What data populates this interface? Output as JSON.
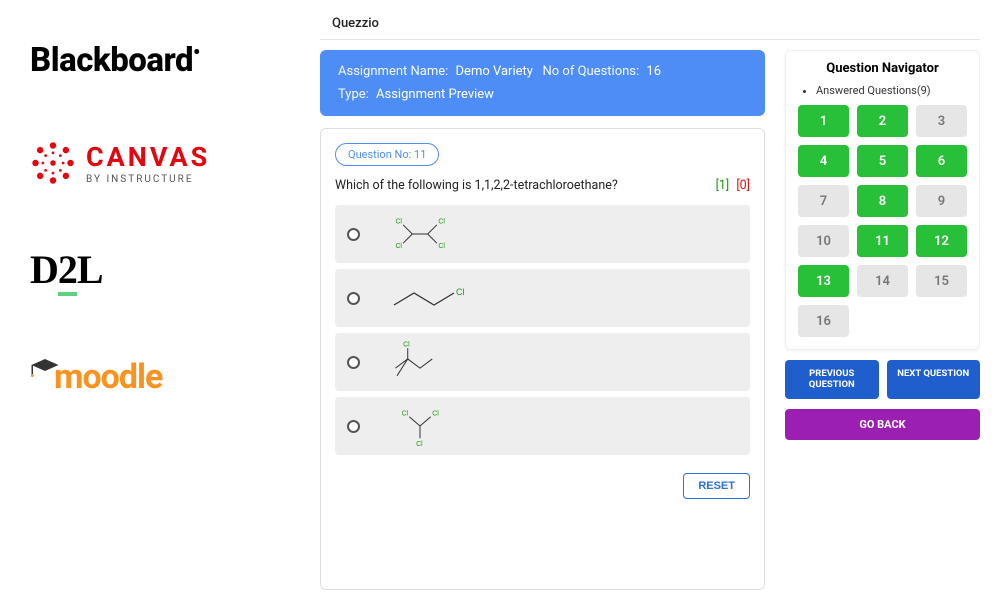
{
  "lms_logos": {
    "blackboard": "Blackboard",
    "canvas_top": "CANVAS",
    "canvas_sub": "BY INSTRUCTURE",
    "d2l": "D2L",
    "moodle": "moodle"
  },
  "app_title": "Quezzio",
  "info": {
    "assignment_label": "Assignment Name:",
    "assignment_value": "Demo Variety",
    "count_label": "No of Questions:",
    "count_value": "16",
    "type_label": "Type:",
    "type_value": "Assignment Preview"
  },
  "question": {
    "badge": "Question No: 11",
    "prompt": "Which of the following is 1,1,2,2-tetrachloroethane?",
    "score_attempt": "[1]",
    "score_missed": "[0]",
    "reset_label": "RESET"
  },
  "navigator": {
    "title": "Question Navigator",
    "legend": "Answered Questions(9)",
    "cells": [
      {
        "n": "1",
        "answered": true
      },
      {
        "n": "2",
        "answered": true
      },
      {
        "n": "3",
        "answered": false
      },
      {
        "n": "4",
        "answered": true
      },
      {
        "n": "5",
        "answered": true
      },
      {
        "n": "6",
        "answered": true
      },
      {
        "n": "7",
        "answered": false
      },
      {
        "n": "8",
        "answered": true
      },
      {
        "n": "9",
        "answered": false
      },
      {
        "n": "10",
        "answered": false
      },
      {
        "n": "11",
        "answered": true
      },
      {
        "n": "12",
        "answered": true
      },
      {
        "n": "13",
        "answered": true
      },
      {
        "n": "14",
        "answered": false
      },
      {
        "n": "15",
        "answered": false
      },
      {
        "n": "16",
        "answered": false
      }
    ],
    "prev_label": "PREVIOUS QUESTION",
    "next_label": "NEXT QUESTION",
    "goback_label": "GO BACK"
  }
}
